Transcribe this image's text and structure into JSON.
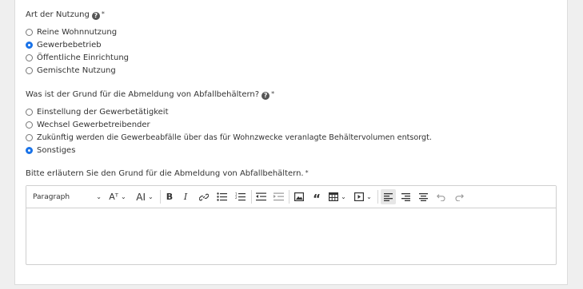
{
  "question1": {
    "label": "Art der Nutzung",
    "help": "?",
    "required": "*",
    "options": [
      {
        "label": "Reine Wohnnutzung",
        "selected": false
      },
      {
        "label": "Gewerbebetrieb",
        "selected": true
      },
      {
        "label": "Öffentliche Einrichtung",
        "selected": false
      },
      {
        "label": "Gemischte Nutzung",
        "selected": false
      }
    ]
  },
  "question2": {
    "label": "Was ist der Grund für die Abmeldung von Abfallbehältern?",
    "help": "?",
    "required": "*",
    "options": [
      {
        "label": "Einstellung der Gewerbetätigkeit",
        "selected": false
      },
      {
        "label": "Wechsel Gewerbetreibender",
        "selected": false
      },
      {
        "label": "Zukünftig werden die Gewerbeabfälle über das für Wohnzwecke veranlagte Behältervolumen entsorgt.",
        "selected": false
      },
      {
        "label": "Sonstiges",
        "selected": true
      }
    ]
  },
  "textarea": {
    "label": "Bitte erläutern Sie den Grund für die Abmeldung von Abfallbehältern.",
    "required": "*",
    "value": ""
  },
  "toolbar": {
    "paragraph_label": "Paragraph",
    "font_size_glyph": "Aᵀ",
    "font_family_glyph": "AI",
    "bold": "B",
    "italic": "I",
    "active_tool": "align-left"
  },
  "colors": {
    "accent": "#1a73e8",
    "background": "#efefef",
    "panel": "#ffffff",
    "border": "#cfcfcf"
  }
}
